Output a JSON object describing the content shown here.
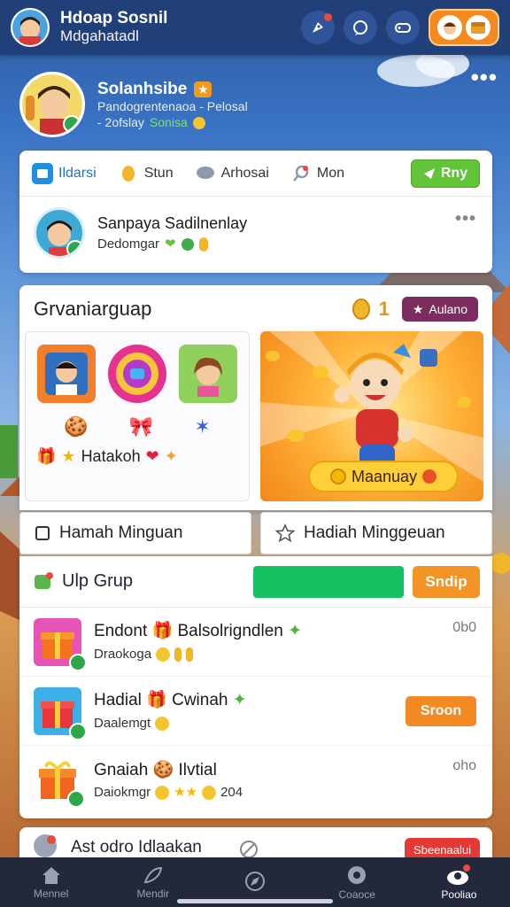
{
  "topbar": {
    "title": "Hdoap Sosnil",
    "subtitle": "Mdgahatadl",
    "icons": [
      "rocket-icon",
      "chat-icon",
      "gamepad-icon"
    ]
  },
  "profile": {
    "name": "Solanhsibe",
    "line1": "Pandogrentenaoa  - Pelosal",
    "line2_prefix": "- 2ofslay",
    "line2_green": "Sonisa"
  },
  "tabs": {
    "items": [
      {
        "label": "Ildarsi",
        "icon": "photo-icon"
      },
      {
        "label": "Stun",
        "icon": "coin-icon"
      },
      {
        "label": "Arhosai",
        "icon": "chat-bubble-icon"
      },
      {
        "label": "Mon",
        "icon": "pin-icon"
      }
    ],
    "reply_label": "Rny"
  },
  "feed": {
    "title": "Sanpaya Sadilnenlay",
    "subtitle": "Dedomgar"
  },
  "section": {
    "title": "Grvaniarguap",
    "coin_count": "1",
    "pill_label": "Aulano",
    "grid_footer": "Hatakoh",
    "banner_label": "Maanuay"
  },
  "subtabs": {
    "left": "Hamah Minguan",
    "right": "Hadiah Minggeuan"
  },
  "list": {
    "title": "Ulp Grup",
    "action_label": "Sndip",
    "rows": [
      {
        "title": "Endont",
        "title2": "Balsolrigndlen",
        "subtitle": "Draokoga",
        "right": "0b0"
      },
      {
        "title": "Hadial",
        "title2": "Cwinah",
        "subtitle": "Daalemgt",
        "button": "Sroon"
      },
      {
        "title": "Gnaiah",
        "title2": "Ilvtial",
        "subtitle": "Daiokmgr",
        "subtitle_num": "204",
        "right": "oho"
      }
    ]
  },
  "peek": {
    "title": "Ast odro Idlaakan",
    "badge": "Sbeenaalui"
  },
  "bottomnav": {
    "items": [
      {
        "label": "Mennel",
        "icon": "home-icon"
      },
      {
        "label": "Mendir",
        "icon": "feather-icon"
      },
      {
        "label": "",
        "icon": "compass-icon"
      },
      {
        "label": "Coaoce",
        "icon": "target-icon"
      },
      {
        "label": "Pooliao",
        "icon": "profile-icon"
      }
    ]
  },
  "colors": {
    "topbar": "#21407a",
    "accent_green": "#63c43a",
    "accent_orange": "#f39427",
    "bar_green": "#14c262",
    "pill": "#7a2d5e"
  }
}
